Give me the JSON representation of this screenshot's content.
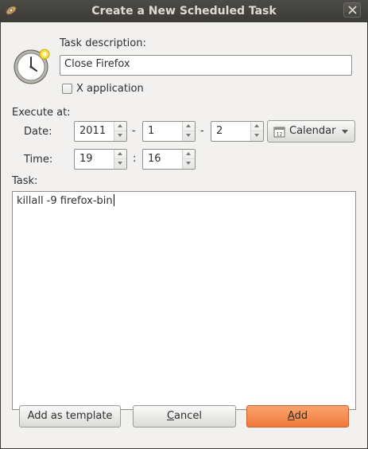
{
  "window": {
    "title": "Create a New Scheduled Task"
  },
  "icons": {
    "app": "scheduler-icon",
    "close": "close-icon",
    "clock": "clock-icon",
    "calendar": "calendar-icon",
    "dropdown": "chevron-down-icon"
  },
  "form": {
    "task_description_label": "Task description:",
    "task_description_value": "Close Firefox",
    "x_application_label": "X application",
    "x_application_checked": false,
    "execute_at_label": "Execute at:",
    "date_label": "Date:",
    "year": "2011",
    "month": "1",
    "day": "2",
    "date_separator": "-",
    "calendar_button": "Calendar",
    "time_label": "Time:",
    "hour": "19",
    "minute": "16",
    "time_separator": ":",
    "task_label": "Task:",
    "task_command": "killall -9 firefox-bin"
  },
  "buttons": {
    "add_template": "Add as template",
    "cancel_mnemonic": "C",
    "cancel_rest": "ancel",
    "add_mnemonic": "A",
    "add_rest": "dd"
  },
  "colors": {
    "titlebar": "#3c3b37",
    "dialog_bg": "#f2f1f0",
    "accent": "#f07a3c"
  }
}
